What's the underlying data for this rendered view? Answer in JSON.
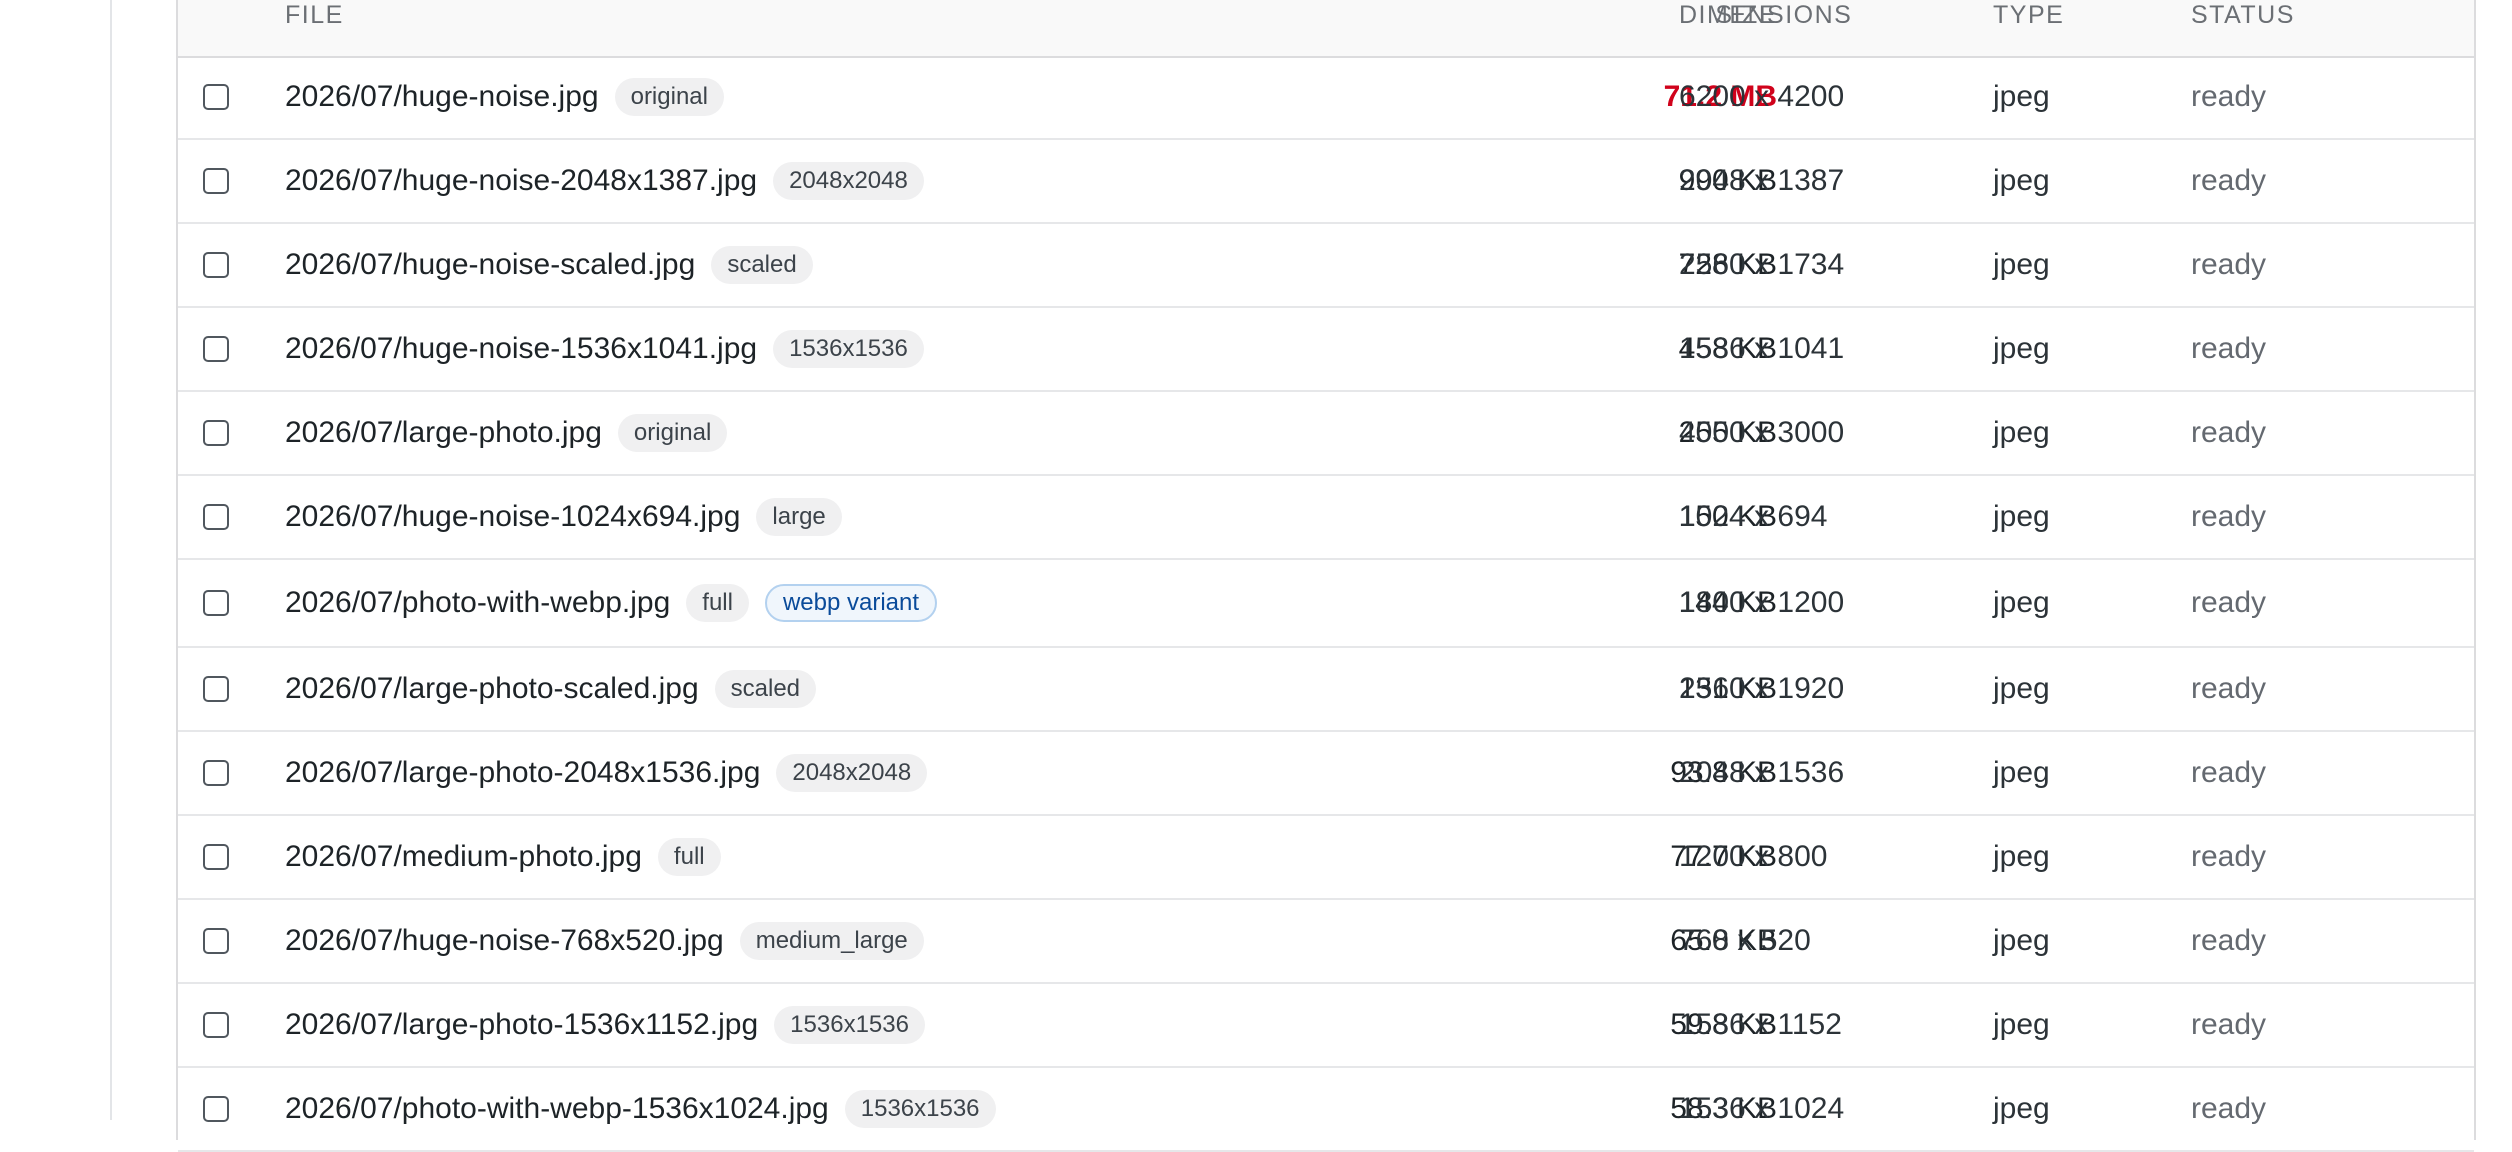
{
  "table": {
    "headers": {
      "file": "FILE",
      "size": "SIZE",
      "dimensions": "DIMENSIONS",
      "type": "TYPE",
      "status": "STATUS"
    },
    "rows": [
      {
        "file": "2026/07/huge-noise.jpg",
        "badges": [
          {
            "label": "original",
            "kind": "plain"
          }
        ],
        "size": "71.2 MB",
        "size_warning": true,
        "dimensions": "6200 x 4200",
        "type": "jpeg",
        "status": "ready"
      },
      {
        "file": "2026/07/huge-noise-2048x1387.jpg",
        "badges": [
          {
            "label": "2048x2048",
            "kind": "plain"
          }
        ],
        "size": "990 KB",
        "size_warning": false,
        "dimensions": "2048 x 1387",
        "type": "jpeg",
        "status": "ready"
      },
      {
        "file": "2026/07/huge-noise-scaled.jpg",
        "badges": [
          {
            "label": "scaled",
            "kind": "plain"
          }
        ],
        "size": "728 KB",
        "size_warning": false,
        "dimensions": "2560 x 1734",
        "type": "jpeg",
        "status": "ready"
      },
      {
        "file": "2026/07/huge-noise-1536x1041.jpg",
        "badges": [
          {
            "label": "1536x1536",
            "kind": "plain"
          }
        ],
        "size": "458 KB",
        "size_warning": false,
        "dimensions": "1536 x 1041",
        "type": "jpeg",
        "status": "ready"
      },
      {
        "file": "2026/07/large-photo.jpg",
        "badges": [
          {
            "label": "original",
            "kind": "plain"
          }
        ],
        "size": "255 KB",
        "size_warning": false,
        "dimensions": "4000 x 3000",
        "type": "jpeg",
        "status": "ready"
      },
      {
        "file": "2026/07/huge-noise-1024x694.jpg",
        "badges": [
          {
            "label": "large",
            "kind": "plain"
          }
        ],
        "size": "150 KB",
        "size_warning": false,
        "dimensions": "1024 x 694",
        "type": "jpeg",
        "status": "ready"
      },
      {
        "file": "2026/07/photo-with-webp.jpg",
        "badges": [
          {
            "label": "full",
            "kind": "plain"
          },
          {
            "label": "webp variant",
            "kind": "webp"
          }
        ],
        "size": "144 KB",
        "size_warning": false,
        "dimensions": "1800 x 1200",
        "type": "jpeg",
        "status": "ready"
      },
      {
        "file": "2026/07/large-photo-scaled.jpg",
        "badges": [
          {
            "label": "scaled",
            "kind": "plain"
          }
        ],
        "size": "131 KB",
        "size_warning": false,
        "dimensions": "2560 x 1920",
        "type": "jpeg",
        "status": "ready"
      },
      {
        "file": "2026/07/large-photo-2048x1536.jpg",
        "badges": [
          {
            "label": "2048x2048",
            "kind": "plain"
          }
        ],
        "size": "93.8 KB",
        "size_warning": false,
        "dimensions": "2048 x 1536",
        "type": "jpeg",
        "status": "ready"
      },
      {
        "file": "2026/07/medium-photo.jpg",
        "badges": [
          {
            "label": "full",
            "kind": "plain"
          }
        ],
        "size": "77.7 KB",
        "size_warning": false,
        "dimensions": "1200 x 800",
        "type": "jpeg",
        "status": "ready"
      },
      {
        "file": "2026/07/huge-noise-768x520.jpg",
        "badges": [
          {
            "label": "medium_large",
            "kind": "plain"
          }
        ],
        "size": "65.0 KB",
        "size_warning": false,
        "dimensions": "768 x 520",
        "type": "jpeg",
        "status": "ready"
      },
      {
        "file": "2026/07/large-photo-1536x1152.jpg",
        "badges": [
          {
            "label": "1536x1536",
            "kind": "plain"
          }
        ],
        "size": "59.8 KB",
        "size_warning": false,
        "dimensions": "1536 x 1152",
        "type": "jpeg",
        "status": "ready"
      },
      {
        "file": "2026/07/photo-with-webp-1536x1024.jpg",
        "badges": [
          {
            "label": "1536x1536",
            "kind": "plain"
          }
        ],
        "size": "58.3 KB",
        "size_warning": false,
        "dimensions": "1536 x 1024",
        "type": "jpeg",
        "status": "ready"
      }
    ]
  },
  "colors": {
    "size_warning": "#d0021b",
    "webp_badge_text": "#0a4b9a",
    "header_text": "#6b6f74"
  }
}
